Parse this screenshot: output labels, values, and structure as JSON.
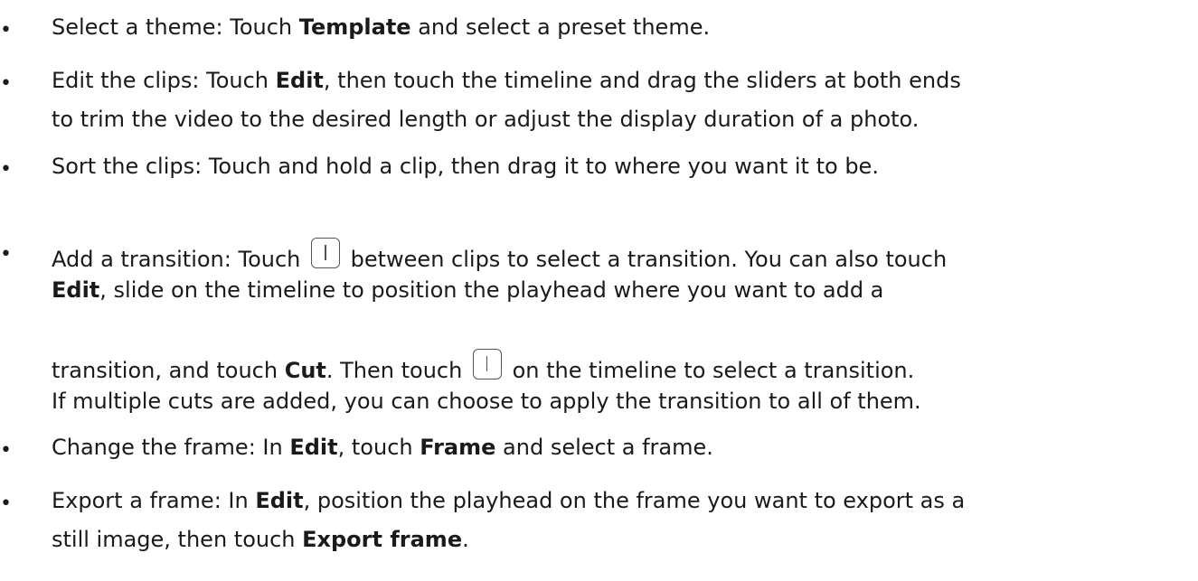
{
  "bullet_char": "•",
  "items": [
    {
      "t1": "Select a theme: Touch ",
      "b1": "Template",
      "t2": " and select a preset theme."
    },
    {
      "t1": "Edit the clips: Touch ",
      "b1": "Edit",
      "t2": ", then touch the timeline and drag the sliders at both ends",
      "t3": "to trim the video to the desired length or adjust the display duration of a photo."
    },
    {
      "t1": "Sort the clips: Touch and hold a clip, then drag it to where you want it to be."
    },
    {
      "t1": "Add a transition: Touch ",
      "t2": " between clips to select a transition. You can also touch",
      "b1": "Edit",
      "t3": ", slide on the timeline to position the playhead where you want to add a",
      "t4": "transition, and touch ",
      "b2": "Cut",
      "t5": ". Then touch ",
      "t6": " on the timeline to select a transition.",
      "t7": "If multiple cuts are added, you can choose to apply the transition to all of them."
    },
    {
      "t1": "Change the frame: In ",
      "b1": "Edit",
      "t2": ", touch ",
      "b2": "Frame",
      "t3": " and select a frame."
    },
    {
      "t1": "Export a frame: In ",
      "b1": "Edit",
      "t2": ", position the playhead on the frame you want to export as a",
      "t3": "still image, then touch ",
      "b2": "Export frame",
      "t4": "."
    }
  ]
}
